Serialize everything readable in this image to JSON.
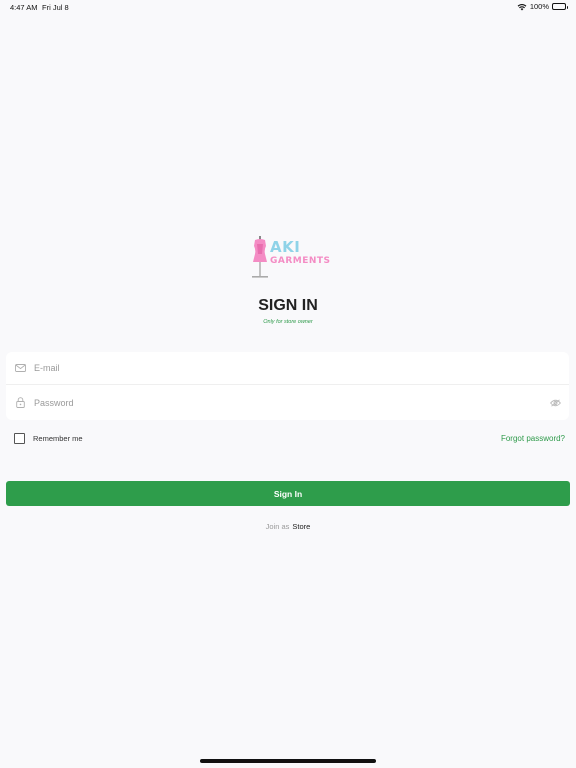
{
  "status_bar": {
    "time": "4:47 AM",
    "date": "Fri Jul 8",
    "battery": "100%",
    "battery_level": 1.0
  },
  "logo": {
    "line1": "AKI",
    "line2": "GARMENTS",
    "icon": "dress-form-icon"
  },
  "header": {
    "title": "SIGN IN",
    "subtitle": "Only for store owner"
  },
  "form": {
    "email_placeholder": "E-mail",
    "email_value": "",
    "email_icon": "mail-icon",
    "password_placeholder": "Password",
    "password_value": "",
    "password_icon": "lock-icon",
    "visibility_icon": "eye-icon",
    "remember_label": "Remember me",
    "remember_checked": false,
    "forgot_label": "Forgot password?"
  },
  "actions": {
    "signin_label": "Sign In",
    "join_prefix": "Join as",
    "join_link": "Store"
  },
  "colors": {
    "accent": "#2e9d4b",
    "background": "#f9f9fb",
    "logo_pink": "#f48cc4",
    "logo_blue": "#8fd3e8"
  }
}
